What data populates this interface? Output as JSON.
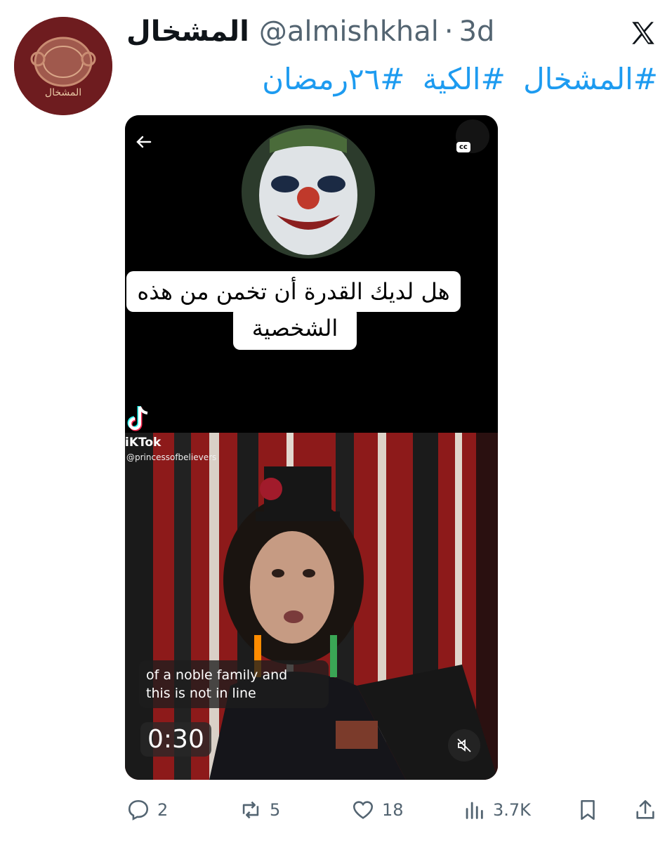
{
  "post": {
    "display_name": "المشخال",
    "handle": "@almishkhal",
    "separator": "·",
    "time": "3d",
    "avatar_label": "المشخال",
    "hashtags": [
      "#المشخال",
      "#الكية",
      "#٢٦رمضان"
    ],
    "verified_icon": "x-logo-icon"
  },
  "media": {
    "cc_label": "cc",
    "quiz_line1": "هل لديك القدرة أن تخمن من هذه",
    "quiz_line2": "الشخصية",
    "tiktok_name": "iKTok",
    "tiktok_user": "@princessofbelievers",
    "caption_line1": "of a noble family and",
    "caption_line2": "this is not in line",
    "timer": "0:30"
  },
  "actions": {
    "replies": "2",
    "reposts": "5",
    "likes": "18",
    "views": "3.7K"
  },
  "colors": {
    "link": "#1d9bf0",
    "muted": "#536471",
    "avatar_bg": "#6e1c1f"
  }
}
